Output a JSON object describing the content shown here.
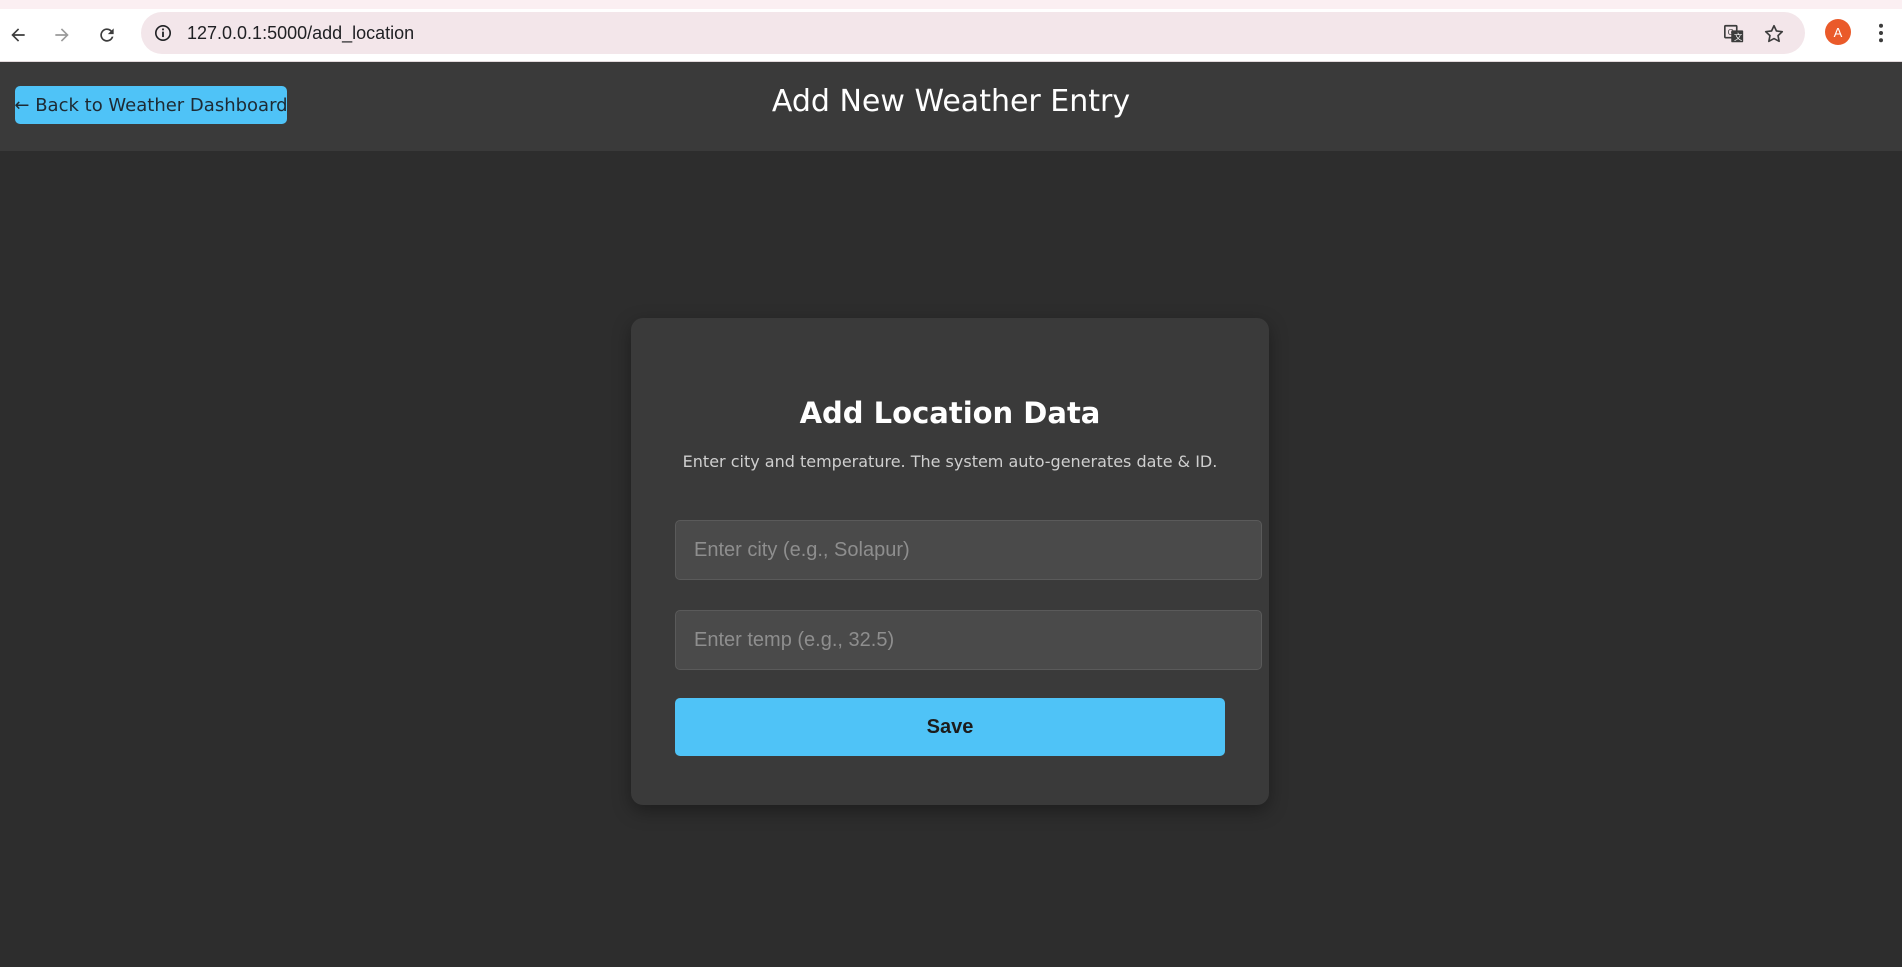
{
  "browser": {
    "url": "127.0.0.1:5000/add_location",
    "profile_initial": "A",
    "icons": {
      "back": "arrow-left-icon",
      "forward": "arrow-right-icon",
      "reload": "reload-icon",
      "site_info": "info-icon",
      "translate": "translate-icon",
      "bookmark": "star-icon",
      "menu": "kebab-menu-icon"
    }
  },
  "header": {
    "back_label": "← Back to Weather Dashboard",
    "title": "Add New Weather Entry"
  },
  "form": {
    "title": "Add Location Data",
    "subtitle": "Enter city and temperature. The system auto-generates date & ID.",
    "city_placeholder": "Enter city (e.g., Solapur)",
    "city_value": "",
    "temp_placeholder": "Enter temp (e.g., 32.5)",
    "temp_value": "",
    "save_label": "Save"
  },
  "colors": {
    "page_background": "#2d2d2d",
    "header_background": "#3a3a3a",
    "accent": "#4fc3f7",
    "avatar": "#ea5a2a"
  }
}
